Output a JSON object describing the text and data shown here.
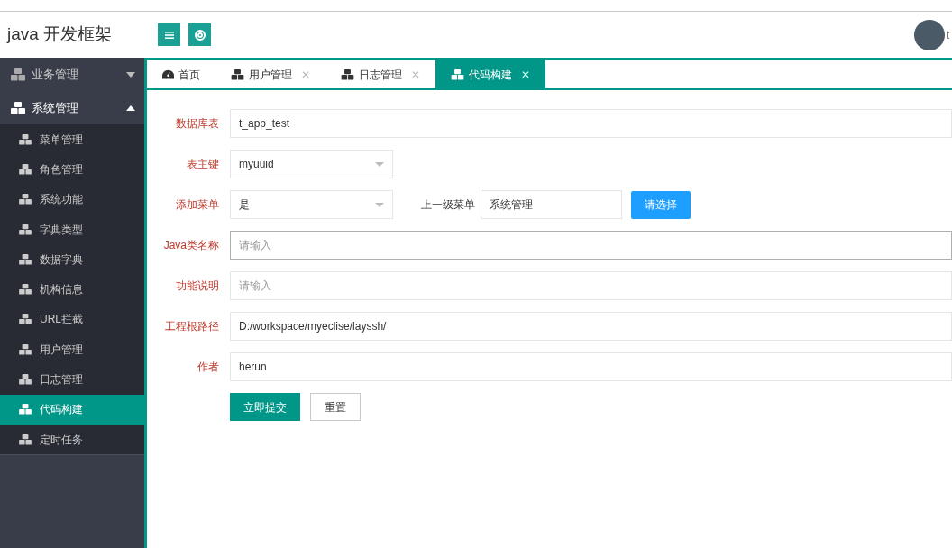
{
  "header": {
    "title": "java 开发框架",
    "username": "t"
  },
  "sidebar": {
    "groups": [
      {
        "label": "业务管理",
        "expanded": false
      },
      {
        "label": "系统管理",
        "expanded": true,
        "children": [
          {
            "label": "菜单管理",
            "selected": false
          },
          {
            "label": "角色管理",
            "selected": false
          },
          {
            "label": "系统功能",
            "selected": false
          },
          {
            "label": "字典类型",
            "selected": false
          },
          {
            "label": "数据字典",
            "selected": false
          },
          {
            "label": "机构信息",
            "selected": false
          },
          {
            "label": "URL拦截",
            "selected": false
          },
          {
            "label": "用户管理",
            "selected": false
          },
          {
            "label": "日志管理",
            "selected": false
          },
          {
            "label": "代码构建",
            "selected": true
          },
          {
            "label": "定时任务",
            "selected": false
          }
        ]
      }
    ]
  },
  "tabs": [
    {
      "label": "首页",
      "kind": "home",
      "selected": false
    },
    {
      "label": "用户管理",
      "kind": "page",
      "close": "✕",
      "selected": false
    },
    {
      "label": "日志管理",
      "kind": "page",
      "close": "✕",
      "selected": false
    },
    {
      "label": "代码构建",
      "kind": "page",
      "close": "✕",
      "selected": true
    }
  ],
  "form": {
    "rows": [
      {
        "label": "数据库表",
        "kind": "text",
        "value": "t_app_test",
        "focused": false
      },
      {
        "label": "表主键",
        "kind": "select",
        "value": "myuuid"
      },
      {
        "label": "添加菜单",
        "kind": "select",
        "value": "是",
        "extra": {
          "label": "上一级菜单",
          "value": "系统管理",
          "button": "请选择"
        }
      },
      {
        "label": "Java类名称",
        "kind": "text",
        "placeholder": "请输入",
        "focused": true
      },
      {
        "label": "功能说明",
        "kind": "text",
        "placeholder": "请输入",
        "focused": false
      },
      {
        "label": "工程根路径",
        "kind": "text",
        "value": "D:/workspace/myeclise/layssh/",
        "focused": false
      },
      {
        "label": "作者",
        "kind": "text",
        "value": "herun",
        "focused": false
      }
    ],
    "buttons": [
      {
        "label": "立即提交",
        "kind": "primary"
      },
      {
        "label": "重置",
        "kind": "secondary"
      }
    ]
  }
}
